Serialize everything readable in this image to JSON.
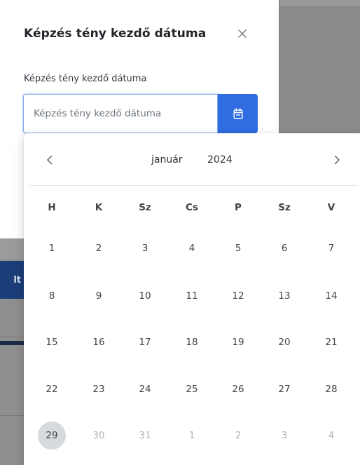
{
  "dialog": {
    "title": "Képzés tény kezdő dátuma",
    "close_icon": "close-icon"
  },
  "field": {
    "label": "Képzés tény kezdő dátuma",
    "placeholder": "Képzés tény kezdő dátuma",
    "value": "",
    "button_icon": "calendar-icon"
  },
  "background": {
    "partial_button_text": "lt"
  },
  "datepicker": {
    "prev_icon": "chevron-left-icon",
    "next_icon": "chevron-right-icon",
    "month": "január",
    "year": "2024",
    "weekdays": [
      "H",
      "K",
      "Sz",
      "Cs",
      "P",
      "Sz",
      "V"
    ],
    "weeks": [
      [
        "1",
        "2",
        "3",
        "4",
        "5",
        "6",
        "7"
      ],
      [
        "8",
        "9",
        "10",
        "11",
        "12",
        "13",
        "14"
      ],
      [
        "15",
        "16",
        "17",
        "18",
        "19",
        "20",
        "21"
      ],
      [
        "22",
        "23",
        "24",
        "25",
        "26",
        "27",
        "28"
      ],
      [
        "29",
        "30",
        "31",
        "1",
        "2",
        "3",
        "4"
      ]
    ],
    "today": "29",
    "other_month_days_in_last_week": [
      "1",
      "2",
      "3",
      "4"
    ]
  },
  "colors": {
    "primary": "#2f6de1",
    "today_bg": "#d6d9de",
    "overlay": "#8a8a8a",
    "muted_text": "#b3b3b3"
  }
}
